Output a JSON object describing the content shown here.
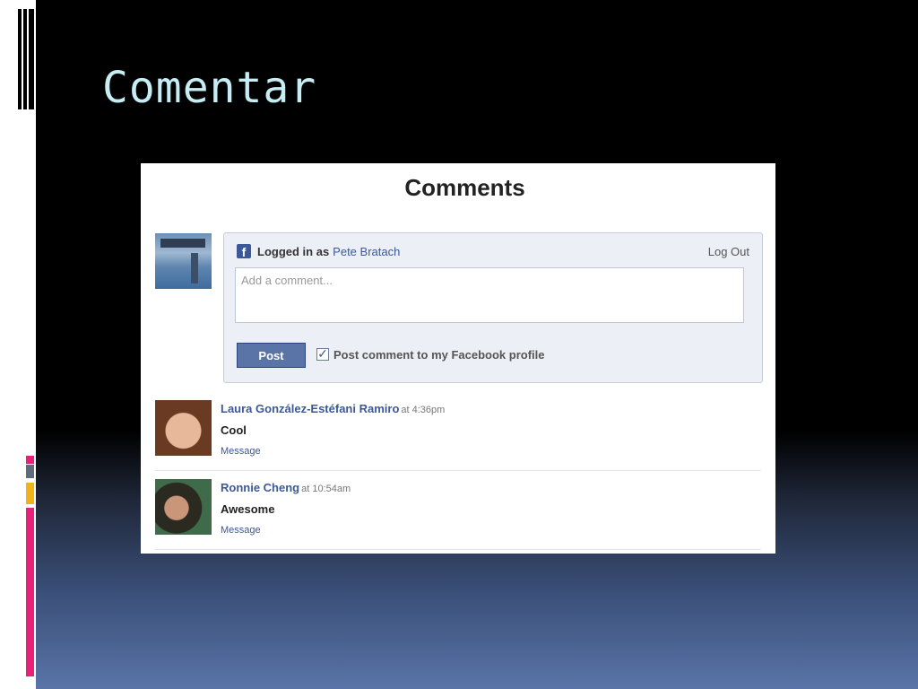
{
  "slide": {
    "title": "Comentar"
  },
  "comments_widget": {
    "heading": "Comments",
    "logged_in_label": "Logged in as",
    "logged_in_user": "Pete Bratach",
    "logout_label": "Log Out",
    "comment_placeholder": "Add a comment...",
    "post_label": "Post",
    "post_to_profile_label": "Post comment to my Facebook profile",
    "post_to_profile_checked": true,
    "comments": [
      {
        "author": "Laura González-Estéfani Ramiro",
        "time": "at 4:36pm",
        "text": "Cool",
        "action": "Message"
      },
      {
        "author": "Ronnie Cheng",
        "time": "at 10:54am",
        "text": "Awesome",
        "action": "Message"
      }
    ]
  },
  "colors": {
    "facebook_blue": "#3b5998",
    "title_color": "#c6ecf4",
    "accent_pink": "#e8207a",
    "accent_yellow": "#f2b21a",
    "accent_gray": "#5f6a7d"
  }
}
